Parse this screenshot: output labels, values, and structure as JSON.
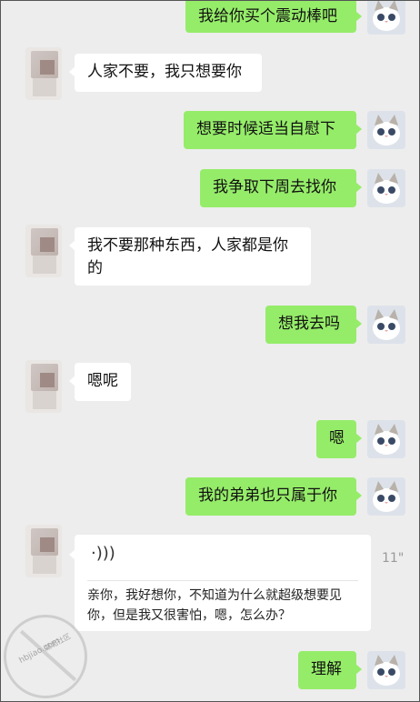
{
  "messages": [
    {
      "text": "我给你买个震动棒吧"
    },
    {
      "text": "人家不要，我只想要你"
    },
    {
      "text": "想要时候适当自慰下"
    },
    {
      "text": "我争取下周去找你"
    },
    {
      "text": "我不要那种东西，人家都是你的"
    },
    {
      "text": "想我去吗"
    },
    {
      "text": "嗯呢"
    },
    {
      "text": "嗯"
    },
    {
      "text": "我的弟弟也只属于你"
    },
    {
      "voice_icon": "voice-icon",
      "duration": "11\"",
      "transcript": "亲你，我好想你，不知道为什么就超级想要见你，但是我又很害怕，嗯，怎么办？"
    },
    {
      "text": "理解"
    }
  ],
  "watermark": {
    "line1": "hbjiao.com",
    "line2": "湖北社区"
  },
  "colors": {
    "self_bubble": "#95ec69",
    "other_bubble": "#ffffff",
    "background": "#ededed"
  }
}
